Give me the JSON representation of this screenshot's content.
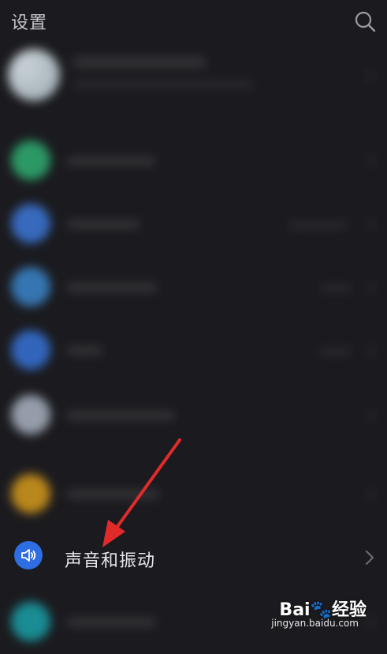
{
  "header": {
    "title": "设置",
    "search_icon": "search-icon"
  },
  "rows": {
    "sound": {
      "label": "声音和振动",
      "icon": "speaker-icon",
      "icon_bg": "#2f6de3"
    }
  },
  "watermark": {
    "brand": "Bai",
    "brand_suffix": "经验",
    "domain": "jingyan.baidu.com"
  },
  "colors": {
    "background": "#1b1b1f",
    "annotation_arrow": "#e12b2b"
  }
}
